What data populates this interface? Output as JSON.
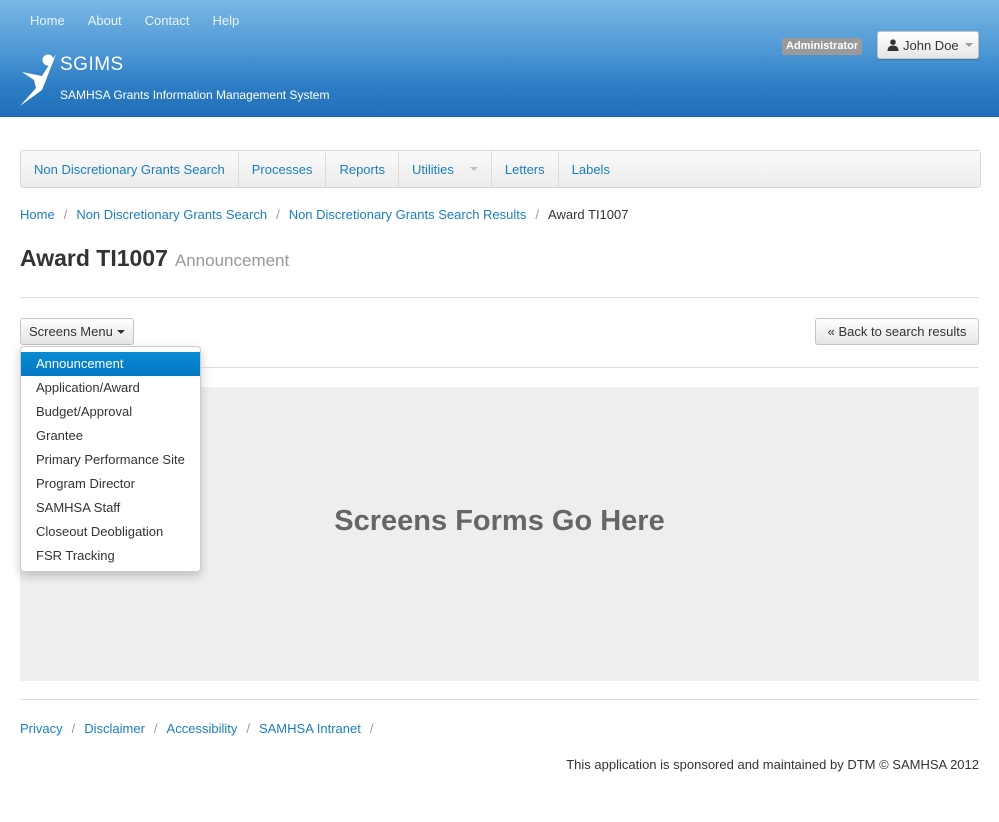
{
  "topnav": [
    "Home",
    "About",
    "Contact",
    "Help"
  ],
  "brand": {
    "title": "SGIMS",
    "subtitle": "SAMHSA Grants Information Management System"
  },
  "user": {
    "role": "Administrator",
    "name": "John Doe"
  },
  "mainnav": [
    "Non Discretionary Grants Search",
    "Processes",
    "Reports",
    "Utilities",
    "Letters",
    "Labels"
  ],
  "breadcrumb": [
    "Home",
    "Non Discretionary Grants Search",
    "Non Discretionary Grants Search Results",
    "Award TI1007"
  ],
  "page": {
    "title": "Award TI1007",
    "subtitle": "Announcement"
  },
  "buttons": {
    "screens_menu": "Screens Menu",
    "back": "« Back to search results"
  },
  "screens_menu_items": [
    "Announcement",
    "Application/Award",
    "Budget/Approval",
    "Grantee",
    "Primary Performance Site",
    "Program Director",
    "SAMHSA Staff",
    "Closeout Deobligation",
    "FSR Tracking"
  ],
  "panel_text": "Screens Forms Go Here",
  "footer": {
    "links": [
      "Privacy",
      "Disclaimer",
      "Accessibility",
      "SAMHSA Intranet"
    ],
    "note": "This application is sponsored and maintained by DTM © SAMHSA 2012"
  },
  "colors": {
    "link": "#1a7fc1",
    "header_top": "#79b8e4",
    "header_bottom": "#2170b9",
    "menu_active": "#0a8bd4"
  },
  "icons": {
    "logo": "runner-figure-icon",
    "user": "person-icon"
  }
}
